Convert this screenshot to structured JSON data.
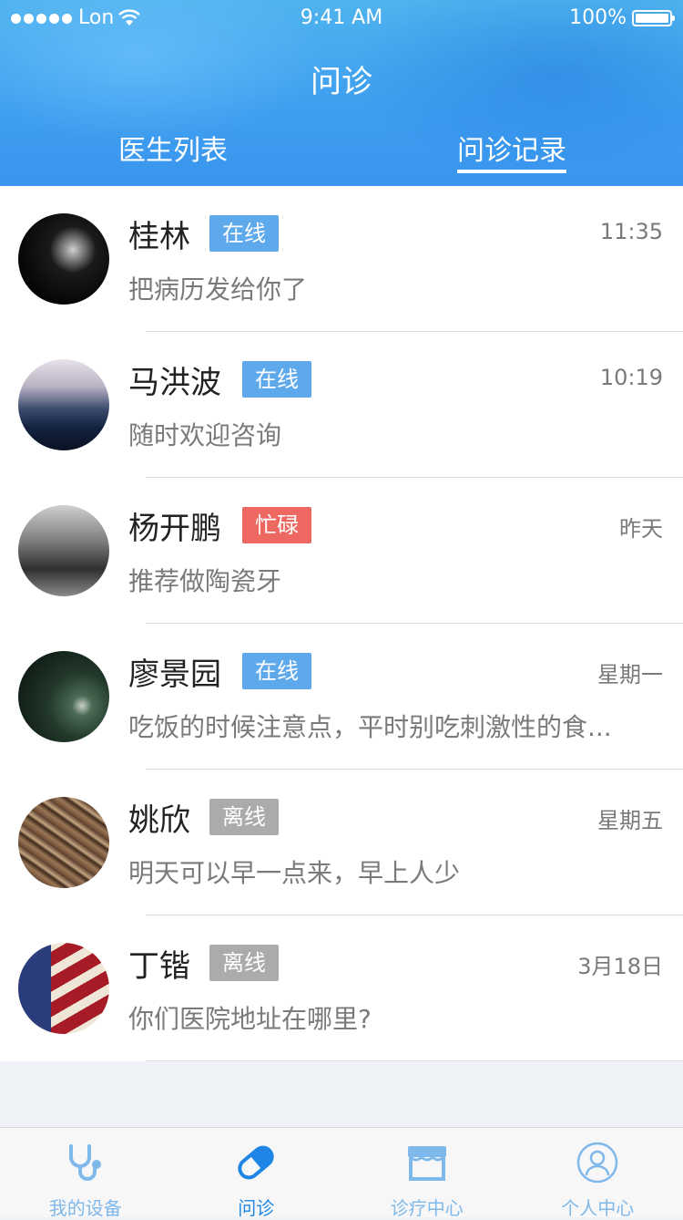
{
  "status_bar": {
    "carrier": "Lon",
    "time": "9:41 AM",
    "battery": "100%"
  },
  "header": {
    "title": "问诊",
    "tabs": [
      {
        "label": "医生列表",
        "active": false
      },
      {
        "label": "问诊记录",
        "active": true
      }
    ]
  },
  "consultations": [
    {
      "name": "桂林",
      "status": "在线",
      "status_type": "online",
      "time": "11:35",
      "message": "把病历发给你了"
    },
    {
      "name": "马洪波",
      "status": "在线",
      "status_type": "online",
      "time": "10:19",
      "message": "随时欢迎咨询"
    },
    {
      "name": "杨开鹏",
      "status": "忙碌",
      "status_type": "busy",
      "time": "昨天",
      "message": "推荐做陶瓷牙"
    },
    {
      "name": "廖景园",
      "status": "在线",
      "status_type": "online",
      "time": "星期一",
      "message": "吃饭的时候注意点，平时别吃刺激性的食..."
    },
    {
      "name": "姚欣",
      "status": "离线",
      "status_type": "offline",
      "time": "星期五",
      "message": "明天可以早一点来，早上人少"
    },
    {
      "name": "丁锴",
      "status": "离线",
      "status_type": "offline",
      "time": "3月18日",
      "message": "你们医院地址在哪里?"
    }
  ],
  "tabbar": {
    "items": [
      {
        "label": "我的设备",
        "icon": "stethoscope-icon",
        "active": false
      },
      {
        "label": "问诊",
        "icon": "pill-icon",
        "active": true
      },
      {
        "label": "诊疗中心",
        "icon": "clinic-icon",
        "active": false
      },
      {
        "label": "个人中心",
        "icon": "user-icon",
        "active": false
      }
    ]
  },
  "colors": {
    "header_blue": "#3d9ef0",
    "online": "#5ea9ec",
    "busy": "#ee6862",
    "offline": "#ababab",
    "tab_active": "#1f86e6",
    "tab_inactive": "#7fb8ea"
  }
}
